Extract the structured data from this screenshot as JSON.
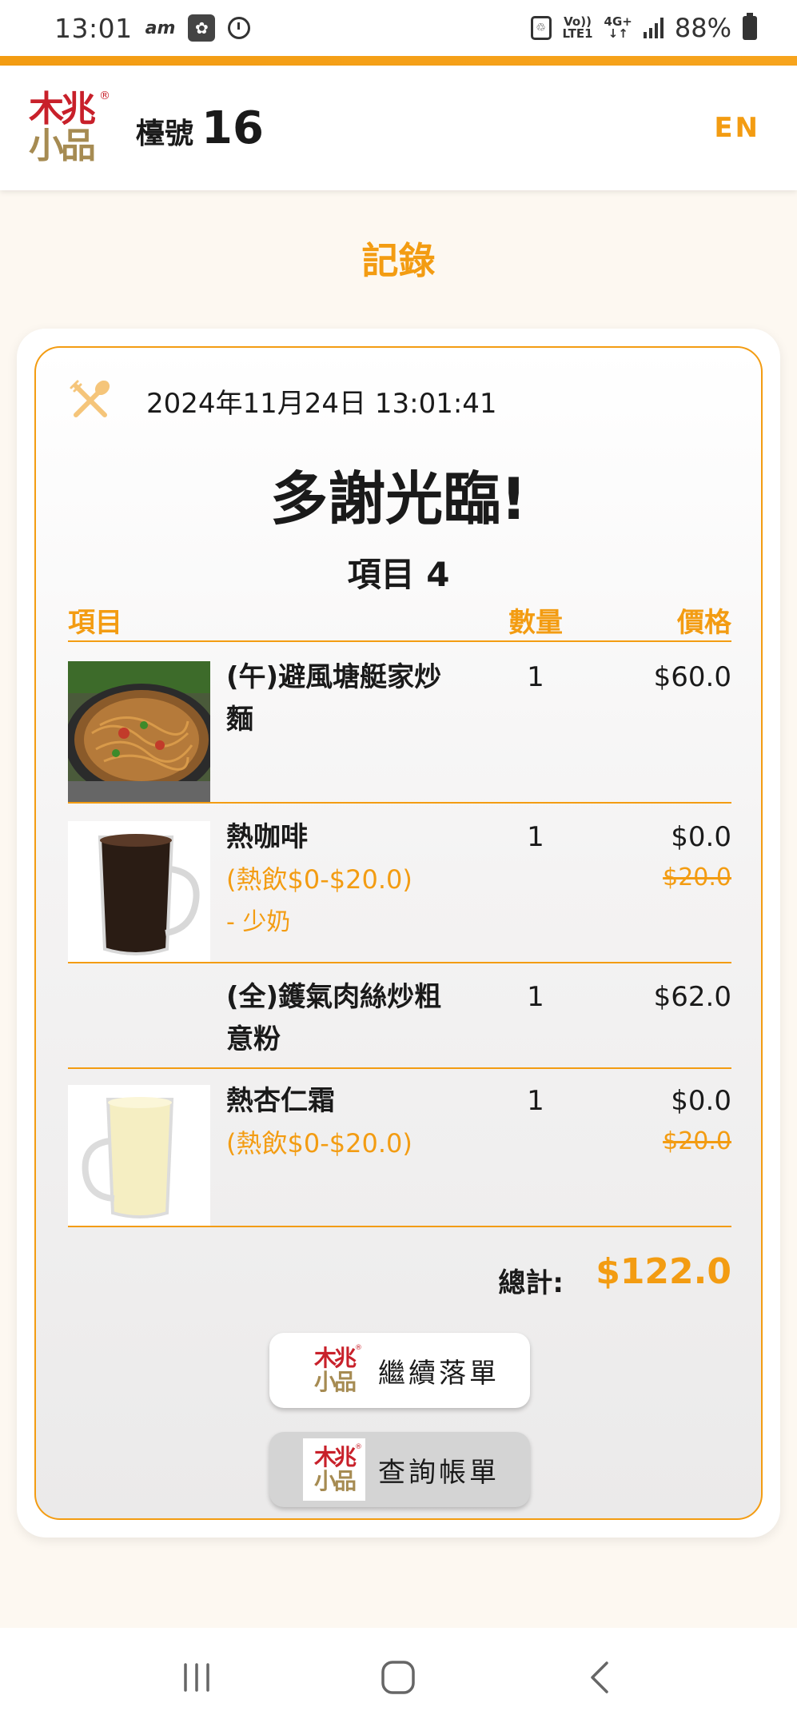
{
  "status_bar": {
    "time": "13:01",
    "am_label": "am",
    "network_top": "Vo))",
    "network_bottom": "LTE1",
    "network_type": "4G+",
    "battery": "88%"
  },
  "header": {
    "logo_top": "木兆",
    "logo_bottom": "小品",
    "logo_reg": "®",
    "counter_label": "檯號",
    "counter_value": "16",
    "language_toggle": "EN"
  },
  "page": {
    "title": "記錄"
  },
  "receipt": {
    "date": "2024年11月24日 13:01:41",
    "thanks": "多謝光臨!",
    "item_count_label": "項目",
    "item_count_value": "4",
    "columns": {
      "item": "項目",
      "quantity": "數量",
      "price": "價格"
    },
    "items": [
      {
        "name": "(午)避風塘艇家炒麵",
        "sub": "",
        "modifier": "",
        "quantity": "1",
        "price": "$60.0",
        "original_price": ""
      },
      {
        "name": "熱咖啡",
        "sub": "(熱飲$0-$20.0)",
        "modifier": "- 少奶",
        "quantity": "1",
        "price": "$0.0",
        "original_price": "$20.0"
      },
      {
        "name": "(全)鑊氣肉絲炒粗意粉",
        "sub": "",
        "modifier": "",
        "quantity": "1",
        "price": "$62.0",
        "original_price": ""
      },
      {
        "name": "熱杏仁霜",
        "sub": "(熱飲$0-$20.0)",
        "modifier": "",
        "quantity": "1",
        "price": "$0.0",
        "original_price": "$20.0"
      }
    ],
    "total_label": "總計:",
    "total_value": "$122.0"
  },
  "actions": {
    "continue_label": "繼續落單",
    "bill_label": "查詢帳單"
  },
  "colors": {
    "accent": "#f39c12",
    "logo_red": "#c8202a",
    "logo_gold": "#a68b52"
  },
  "icons": {
    "utensil": "fork-spoon-icon",
    "nav_recent": "recent-apps-icon",
    "nav_home": "home-icon",
    "nav_back": "back-icon"
  }
}
